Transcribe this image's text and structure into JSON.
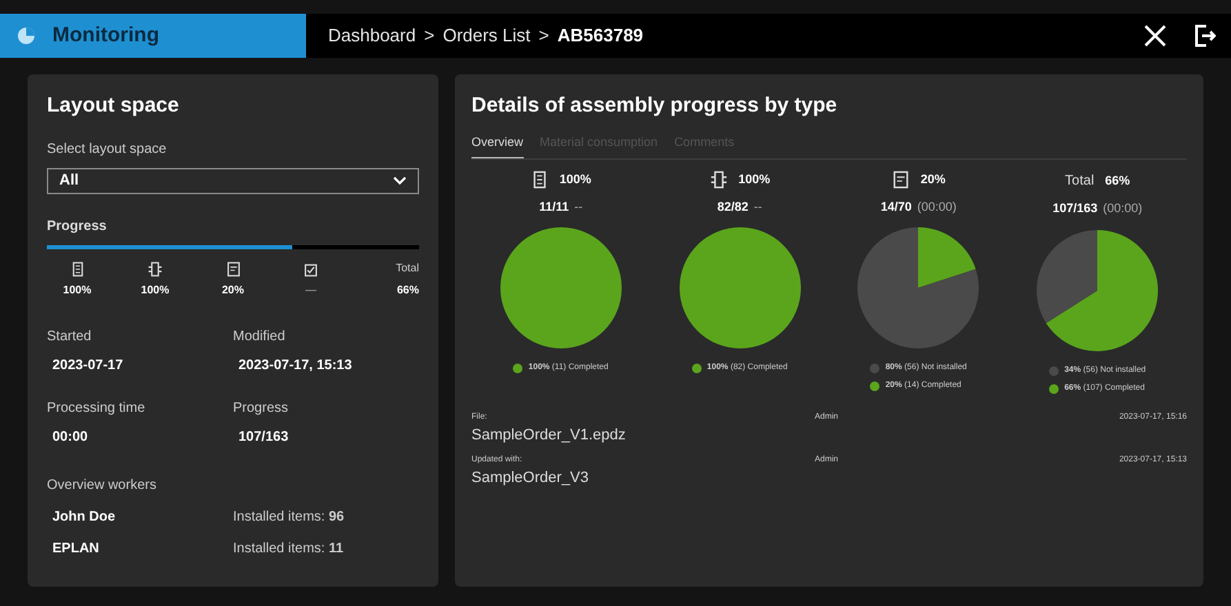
{
  "header": {
    "app_title": "Monitoring",
    "breadcrumb": [
      {
        "label": "Dashboard",
        "current": false
      },
      {
        "label": "Orders List",
        "current": false
      },
      {
        "label": "AB563789",
        "current": true
      }
    ],
    "separator": ">"
  },
  "layout_panel": {
    "title": "Layout space",
    "select_label": "Select layout space",
    "select_value": "All",
    "progress_label": "Progress",
    "level": 0.66,
    "type_stats": [
      {
        "kind": "cabinet",
        "value": "100%"
      },
      {
        "kind": "component",
        "value": "100%"
      },
      {
        "kind": "panel",
        "value": "20%"
      },
      {
        "kind": "check",
        "value": "—"
      },
      {
        "kind": "total",
        "label": "Total",
        "value": "66%"
      }
    ],
    "fields": [
      {
        "label": "Started",
        "value": "2023-07-17"
      },
      {
        "label": "Modified",
        "value": "2023-07-17, 15:13"
      },
      {
        "label": "Processing time",
        "value": "00:00"
      },
      {
        "label": "Progress",
        "value": "107/163"
      }
    ],
    "workers_label": "Overview workers",
    "workers": [
      {
        "name": "John Doe",
        "installed": "Installed items: **96**"
      },
      {
        "name": "EPLAN",
        "installed": "Installed items: **11**"
      }
    ]
  },
  "details_panel": {
    "title": "Details of assembly progress by type",
    "tabs": [
      {
        "label": "Overview",
        "selected": true
      },
      {
        "label": "Material consumption",
        "selected": false
      },
      {
        "label": "Comments",
        "selected": false
      }
    ],
    "cards": [
      {
        "kind": "cabinet",
        "percent": "100%",
        "count": "11/11",
        "time": "--",
        "legend": [
          {
            "text": "**100%** (11) Completed",
            "color": "#5aa51c"
          }
        ],
        "chart_data": {
          "type": "pie",
          "values": [
            100
          ]
        }
      },
      {
        "kind": "component",
        "percent": "100%",
        "count": "82/82",
        "time": "--",
        "legend": [
          {
            "text": "**100%** (82) Completed",
            "color": "#5aa51c"
          }
        ],
        "chart_data": {
          "type": "pie",
          "values": [
            100
          ]
        }
      },
      {
        "kind": "panel",
        "percent": "20%",
        "count": "14/70",
        "time": "(00:00)",
        "legend": [
          {
            "text": "**80%** (56) Not installed",
            "color": "#4a4a4a"
          },
          {
            "text": "**20%** (14) Completed",
            "color": "#5aa51c"
          }
        ],
        "chart_data": {
          "type": "pie",
          "values": [
            80,
            20
          ]
        }
      },
      {
        "kind": "total",
        "label": "Total",
        "percent": "66%",
        "count": "107/163",
        "time": "(00:00)",
        "legend": [
          {
            "text": "**34%** (56) Not installed",
            "color": "#4a4a4a"
          },
          {
            "text": "**66%** (107) Completed",
            "color": "#5aa51c"
          }
        ],
        "chart_data": {
          "type": "pie",
          "values": [
            34,
            66
          ]
        }
      }
    ],
    "files": [
      {
        "label": "File:",
        "name": "SampleOrder_V1.epdz",
        "user": "Admin",
        "date": "2023-07-17, 15:16"
      },
      {
        "label": "Updated with:",
        "name": "SampleOrder_V3",
        "user": "Admin",
        "date": "2023-07-17, 15:13"
      }
    ]
  }
}
